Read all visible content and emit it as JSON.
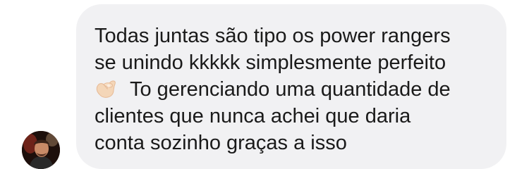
{
  "message": {
    "line1": "Todas juntas são tipo os power rangers",
    "line2": "se unindo kkkkk simplesmente perfeito",
    "emoji": "ok-hand-emoji",
    "line3": "To gerenciando uma quantidade de",
    "line4": "clientes que nunca achei que daria",
    "line5": "conta sozinho graças a isso"
  },
  "colors": {
    "bubble": "#f1f1f3",
    "text": "#1a1a1a",
    "emoji_skin": "#f4d6b8"
  }
}
